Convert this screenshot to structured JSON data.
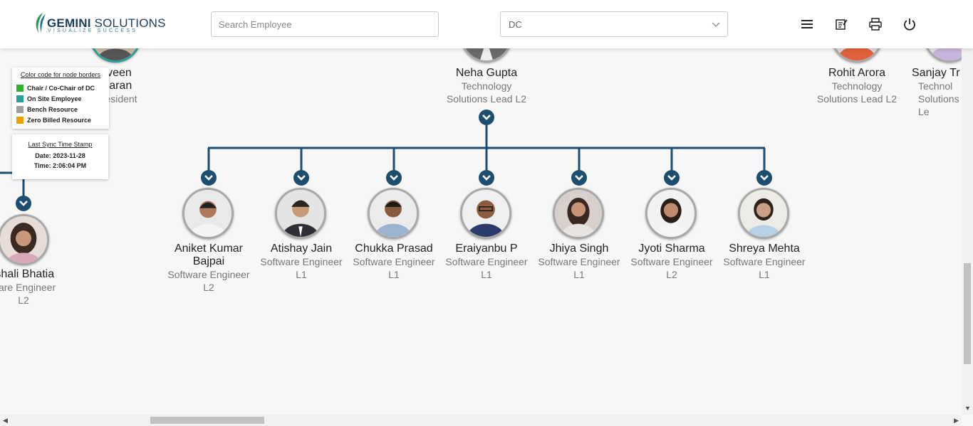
{
  "header": {
    "logo_text_primary": "GEMINI",
    "logo_text_secondary": "SOLUTIONS",
    "logo_tagline": "VISUALIZE SUCCESS",
    "search_placeholder": "Search Employee",
    "department_select_value": "DC",
    "icons": [
      "menu-icon",
      "notes-icon",
      "print-icon",
      "power-icon"
    ]
  },
  "legend": {
    "title": "Color code for node borders",
    "items": [
      {
        "label": "Chair / Co-Chair of DC",
        "color": "#2db52d"
      },
      {
        "label": "On Site Employee",
        "color": "#2aa198"
      },
      {
        "label": "Bench Resource",
        "color": "#a0a0a0"
      },
      {
        "label": "Zero Billed Resource",
        "color": "#f0a000"
      }
    ]
  },
  "sync": {
    "title": "Last Sync Time Stamp",
    "date": "Date: 2023-11-28",
    "time": "Time: 2:06:04 PM"
  },
  "top_nodes": [
    {
      "name": "aveen\niharan",
      "role": "President"
    },
    {
      "name": "Neha Gupta",
      "role": "Technology\nSolutions Lead L2"
    },
    {
      "name": "Rohit Arora",
      "role": "Technology\nSolutions Lead L2"
    },
    {
      "name": "Sanjay Tr",
      "role": "Technol\nSolutions Le"
    }
  ],
  "left_child": {
    "name": "ishali Bhatia",
    "role": "ware Engineer\nL2"
  },
  "children": [
    {
      "name": "Aniket Kumar\nBajpai",
      "role": "Software Engineer\nL2"
    },
    {
      "name": "Atishay Jain",
      "role": "Software Engineer\nL1"
    },
    {
      "name": "Chukka Prasad",
      "role": "Software Engineer\nL1"
    },
    {
      "name": "Eraiyanbu P",
      "role": "Software Engineer\nL1"
    },
    {
      "name": "Jhiya Singh",
      "role": "Software Engineer\nL1"
    },
    {
      "name": "Jyoti Sharma",
      "role": "Software Engineer\nL2"
    },
    {
      "name": "Shreya Mehta",
      "role": "Software Engineer\nL1"
    }
  ],
  "colors": {
    "connector": "#1d4e6f",
    "bench_border": "#a8a8a8",
    "onsite_border": "#2aa198",
    "zero_billed_border": "#e07030"
  }
}
